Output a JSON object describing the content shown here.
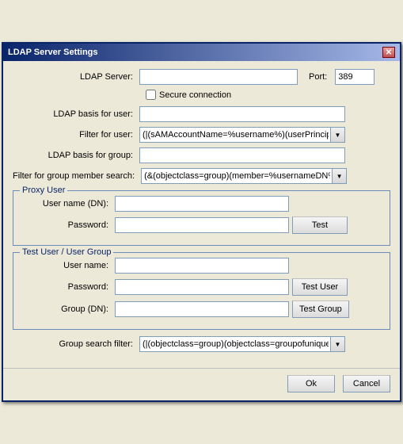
{
  "window": {
    "title": "LDAP Server Settings",
    "close_label": "✕"
  },
  "form": {
    "ldap_server_label": "LDAP Server:",
    "ldap_server_value": "",
    "port_label": "Port:",
    "port_value": "389",
    "secure_label": "Secure connection",
    "ldap_basis_user_label": "LDAP basis for user:",
    "ldap_basis_user_value": "",
    "filter_user_label": "Filter for user:",
    "filter_user_value": "(|(sAMAccountName=%username%)(userPrincipalName=%",
    "ldap_basis_group_label": "LDAP basis for group:",
    "ldap_basis_group_value": "",
    "filter_group_label": "Filter for group member search:",
    "filter_group_value": "(&(objectclass=group)(member=%usernameDN%))",
    "proxy_section": {
      "title": "Proxy User",
      "username_label": "User name (DN):",
      "username_value": "",
      "password_label": "Password:",
      "password_value": "",
      "test_button": "Test"
    },
    "test_section": {
      "title": "Test User / User Group",
      "username_label": "User name:",
      "username_value": "",
      "password_label": "Password:",
      "password_value": "",
      "test_user_button": "Test User",
      "group_label": "Group (DN):",
      "group_value": "",
      "test_group_button": "Test Group"
    },
    "group_search_label": "Group search filter:",
    "group_search_value": "(|(objectclass=group)(objectclass=groupofuniquenames))",
    "ok_button": "Ok",
    "cancel_button": "Cancel"
  }
}
